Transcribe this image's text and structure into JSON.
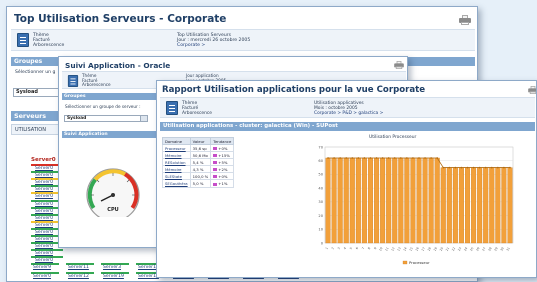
{
  "main_window": {
    "title": "Top Utilisation Serveurs - Corporate",
    "meta_left": [
      "Thème",
      "Facturé",
      "Arborescence"
    ],
    "meta_right": [
      "Top Utilisation Serveurs",
      "Jour : mercredi 26 octobre 2005",
      "Corporate >"
    ],
    "groups_heading": "Groupes",
    "group_prompt": "Sélectionner un g",
    "group_selected": "Sysload",
    "servers_heading": "Serveurs",
    "utilisation_tab": "UTILISATION",
    "highlight_server": "Server0",
    "servers": [
      "Server0",
      "Server0",
      "Server0",
      "Server0",
      "Server0",
      "Server0",
      "Server0",
      "Server0",
      "Server0",
      "Server0",
      "Server0",
      "Server0",
      "Server0",
      "Server0"
    ],
    "bottom_row": [
      "Server9",
      "Server11",
      "Server3",
      "Server15",
      "Server17",
      "Server21",
      "Server22",
      "Server4"
    ],
    "bottom_row2": [
      "Server0",
      "Server12",
      "Server19",
      "Server18",
      "Server18",
      "Server20",
      "Server23",
      "Server40"
    ]
  },
  "middle_window": {
    "title": "Suivi Application - Oracle",
    "meta_left": [
      "Thème",
      "Facturé",
      "Arborescence"
    ],
    "meta_right": [
      "Jour application",
      "Jour : octobre 2005",
      "Corporate > P&D > ..."
    ],
    "groups_heading": "Groupes",
    "group_prompt": "Sélectionner un groupe de serveur :",
    "group_selected": "Sysload",
    "section": "Suivi Application",
    "gauge_label": "CPU"
  },
  "front_window": {
    "title": "Rapport Utilisation applications pour la vue Corporate",
    "meta_left": [
      "Thème",
      "Facturé",
      "Arborescence"
    ],
    "meta_right": [
      "Utilisation applicatives",
      "Mois : octobre 2005",
      "Corporate > P&D > galactica >"
    ],
    "section": "Utilisation applications - cluster: galactica (Win) - SUPost",
    "table_headers": [
      "Domaine",
      "Valeur",
      "Tendance"
    ],
    "table_rows": [
      {
        "app": "Processeur",
        "value": "35,6 sp",
        "trend": "+0%"
      },
      {
        "app": "Mémoire",
        "value": "50,6 Mo",
        "trend": "+15%"
      },
      {
        "app": "RESolution",
        "value": "5,4 %",
        "trend": "+5%"
      },
      {
        "app": "Mémoire",
        "value": "4,3 %",
        "trend": "+2%"
      },
      {
        "app": "SLEState",
        "value": "100,0 %",
        "trend": "+0%"
      },
      {
        "app": "SEGauthéra",
        "value": "5,0 %",
        "trend": "+1%"
      }
    ],
    "chart_title": "Utilisation Processeur",
    "legend": "Processeur"
  },
  "chart_data": {
    "type": "bar",
    "title": "Utilisation Processeur",
    "xlabel": "",
    "ylabel": "",
    "categories": [
      "1",
      "2",
      "3",
      "4",
      "5",
      "6",
      "7",
      "8",
      "9",
      "10",
      "11",
      "12",
      "13",
      "14",
      "15",
      "16",
      "17",
      "18",
      "19",
      "20",
      "21",
      "22",
      "23",
      "24",
      "25",
      "26",
      "27",
      "28",
      "29",
      "30",
      "31"
    ],
    "series": [
      {
        "name": "Processeur",
        "values": [
          62,
          62,
          62,
          62,
          62,
          62,
          62,
          62,
          62,
          62,
          62,
          62,
          62,
          62,
          62,
          62,
          62,
          62,
          62,
          55,
          55,
          55,
          55,
          55,
          55,
          55,
          55,
          55,
          55,
          55,
          55
        ]
      }
    ],
    "ylim": [
      0,
      70
    ],
    "grid": true,
    "legend_position": "bottom",
    "colors": {
      "bar": "#f2a03a",
      "bar_edge": "#c97a1e",
      "line": "#b06a10"
    }
  }
}
